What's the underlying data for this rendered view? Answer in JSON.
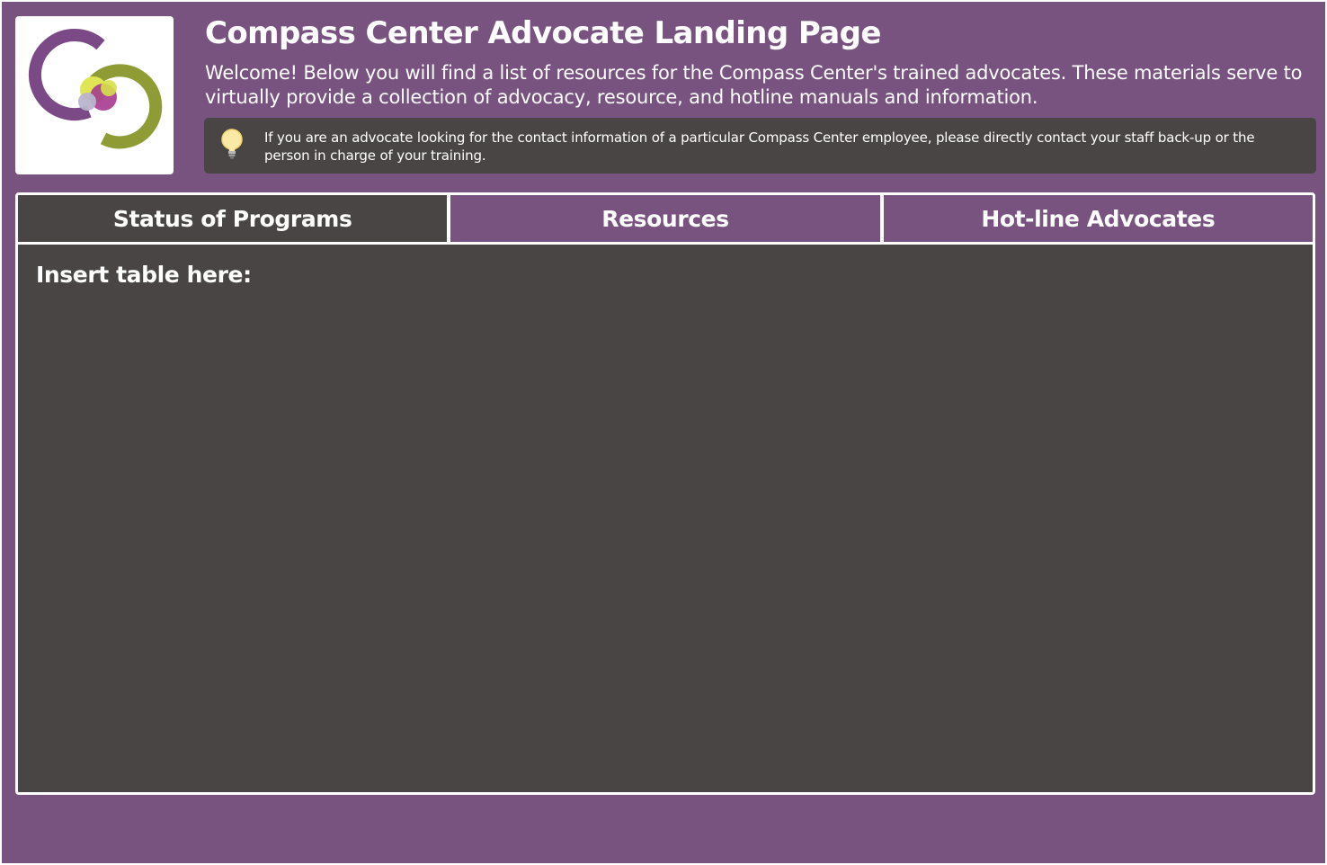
{
  "header": {
    "title": "Compass Center Advocate Landing Page",
    "welcome": "Welcome! Below you will find a list of resources for the Compass Center's trained advocates. These materials serve to virtually provide a collection of advocacy, resource, and hotline manuals and information.",
    "logo_icon": "compass-center-logo"
  },
  "callout": {
    "icon": "lightbulb-icon",
    "text": "If you are an advocate looking for the contact information of a particular Compass Center employee, please directly contact your staff back-up or the person in charge of your training."
  },
  "tabs": [
    {
      "label": "Status of Programs",
      "active": true
    },
    {
      "label": "Resources",
      "active": false
    },
    {
      "label": "Hot-line Advocates",
      "active": false
    }
  ],
  "content": {
    "placeholder": "Insert table here:"
  },
  "colors": {
    "background": "#785380",
    "panel": "#4a4545",
    "text": "#ffffff",
    "logo_purple": "#7b4a86",
    "logo_green": "#8f9c35",
    "logo_yellow": "#e0e653",
    "logo_magenta": "#a63a8f"
  }
}
